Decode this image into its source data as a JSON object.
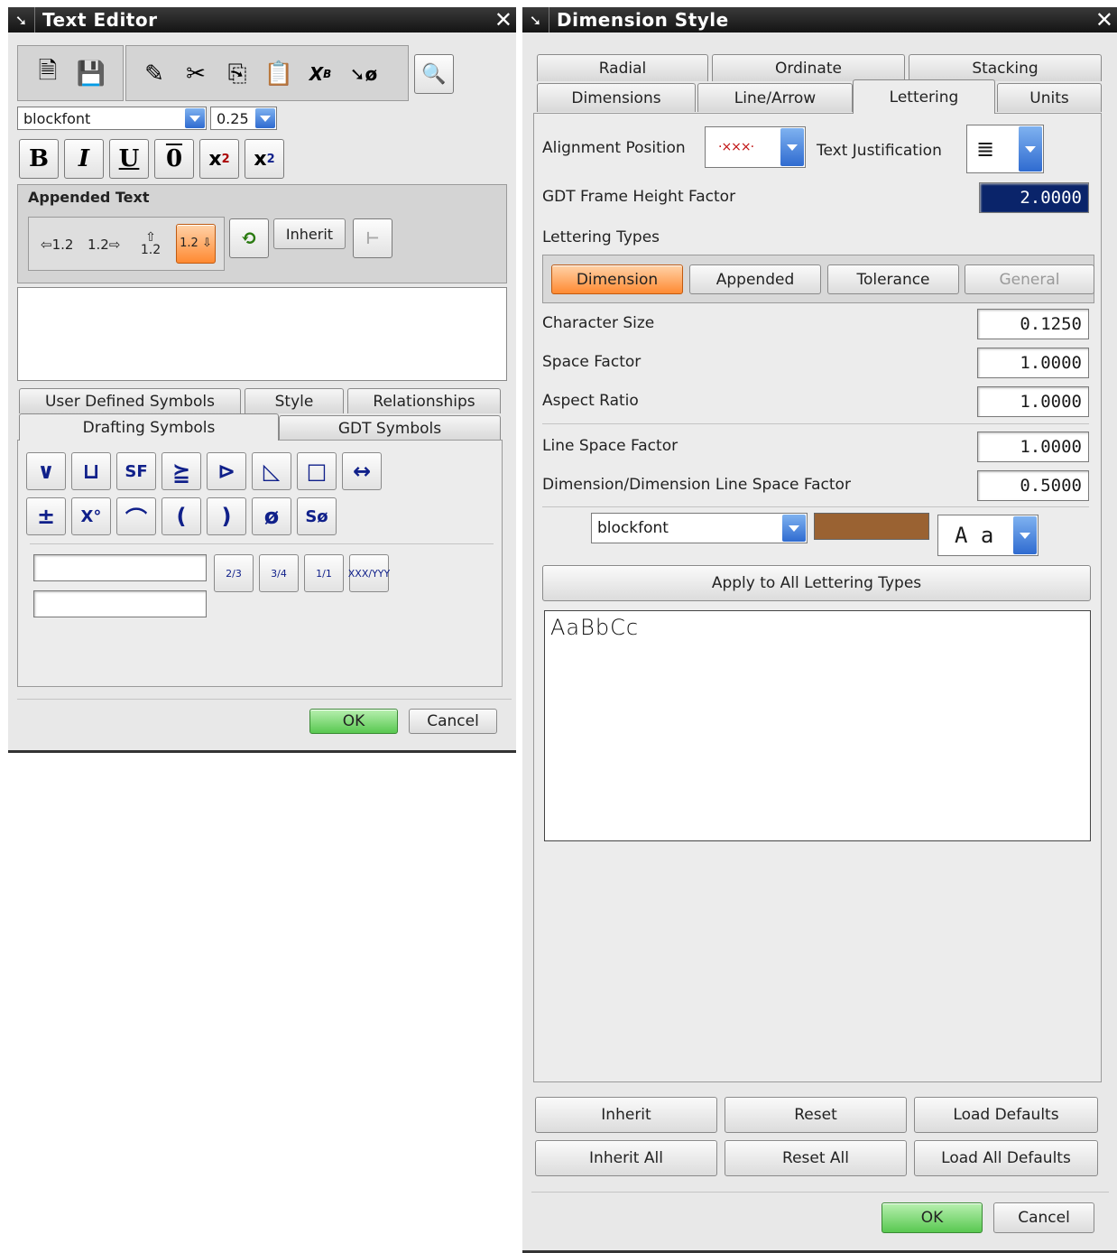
{
  "text_editor": {
    "title": "Text Editor",
    "font": "blockfont",
    "size": "0.25",
    "appended_text_label": "Appended Text",
    "appended_icons": [
      "⇦1.2",
      "1.2⇨",
      "⇧ 1.2",
      "1.2 ⇩"
    ],
    "inherit_label": "Inherit",
    "tabs_row1": [
      "User Defined Symbols",
      "Style",
      "Relationships"
    ],
    "tabs_row2": [
      "Drafting Symbols",
      "GDT Symbols"
    ],
    "symbols_row1": [
      "∨",
      "⊔",
      "SF",
      "⪴",
      "⊳",
      "◺",
      "□",
      "↔"
    ],
    "symbols_row2": [
      "±",
      "X°",
      "⌒",
      "(",
      ")",
      "ø",
      "Sø"
    ],
    "fractions": [
      "2/3",
      "3/4",
      "1/1",
      "XXX/YYY"
    ],
    "ok": "OK",
    "cancel": "Cancel"
  },
  "dimension_style": {
    "title": "Dimension Style",
    "tabs_row1": [
      "Radial",
      "Ordinate",
      "Stacking"
    ],
    "tabs_row2": [
      "Dimensions",
      "Line/Arrow",
      "Lettering",
      "Units"
    ],
    "active_tab": "Lettering",
    "alignment_position_label": "Alignment Position",
    "text_justification_label": "Text Justification",
    "gdt_frame_label": "GDT Frame Height Factor",
    "gdt_frame_value": "2.0000",
    "lettering_types_label": "Lettering Types",
    "lettering_types": [
      "Dimension",
      "Appended",
      "Tolerance",
      "General"
    ],
    "character_size_label": "Character Size",
    "character_size": "0.1250",
    "space_factor_label": "Space Factor",
    "space_factor": "1.0000",
    "aspect_ratio_label": "Aspect Ratio",
    "aspect_ratio": "1.0000",
    "line_space_factor_label": "Line Space Factor",
    "line_space_factor": "1.0000",
    "dim_line_space_label": "Dimension/Dimension Line Space Factor",
    "dim_line_space": "0.5000",
    "font": "blockfont",
    "color": "#9a6232",
    "aa": "A a",
    "apply_all": "Apply to All Lettering Types",
    "preview_text": "AaBbCc",
    "inherit": "Inherit",
    "reset": "Reset",
    "load_defaults": "Load Defaults",
    "inherit_all": "Inherit All",
    "reset_all": "Reset All",
    "load_all_defaults": "Load All Defaults",
    "ok": "OK",
    "cancel": "Cancel"
  }
}
